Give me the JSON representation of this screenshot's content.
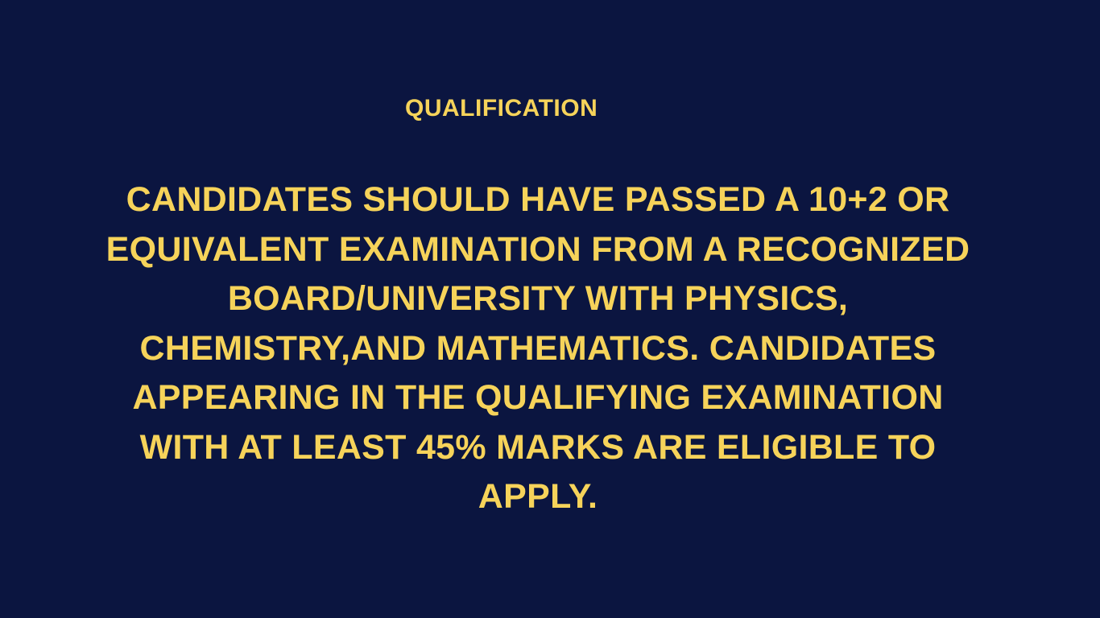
{
  "slide": {
    "heading": "QUALIFICATION",
    "body": "CANDIDATES SHOULD HAVE PASSED A 10+2 OR EQUIVALENT EXAMINATION FROM A RECOGNIZED BOARD/UNIVERSITY WITH PHYSICS, CHEMISTRY,AND MATHEMATICS. CANDIDATES APPEARING IN THE QUALIFYING EXAMINATION WITH AT LEAST 45% MARKS ARE ELIGIBLE TO APPLY.",
    "colors": {
      "background": "#0b1540",
      "text": "#f6d35a"
    }
  }
}
